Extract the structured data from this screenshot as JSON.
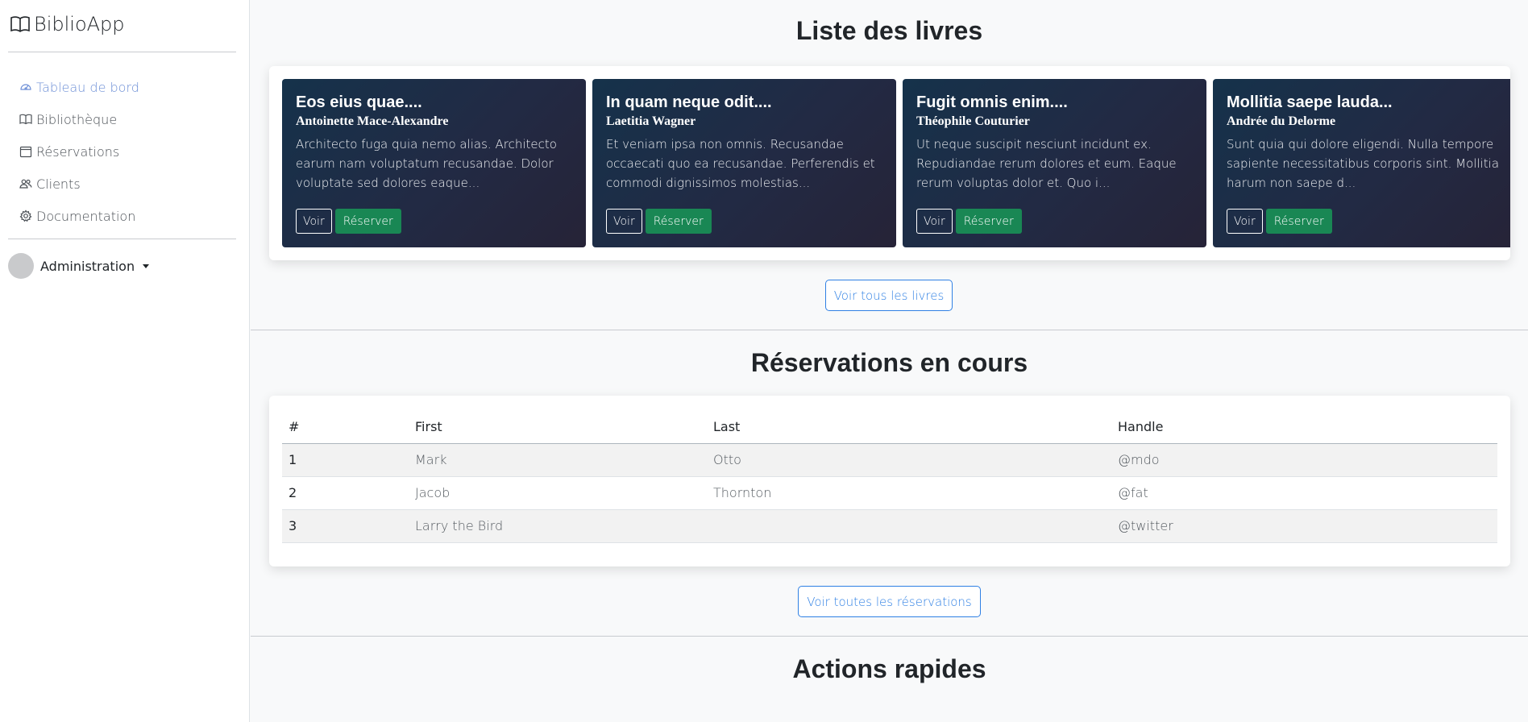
{
  "app": {
    "title": "BiblioApp"
  },
  "sidebar": {
    "items": [
      {
        "label": "Tableau de bord",
        "icon": "speedometer-icon",
        "active": true
      },
      {
        "label": "Bibliothèque",
        "icon": "book-icon"
      },
      {
        "label": "Réservations",
        "icon": "calendar-icon"
      },
      {
        "label": "Clients",
        "icon": "people-icon"
      },
      {
        "label": "Documentation",
        "icon": "gear-icon"
      }
    ],
    "user": {
      "label": "Administration"
    }
  },
  "books": {
    "title": "Liste des livres",
    "view_label": "Voir",
    "reserve_label": "Réserver",
    "all_button": "Voir tous les livres",
    "items": [
      {
        "title": "Eos eius quae....",
        "author": "Antoinette Mace-Alexandre",
        "description": "Architecto fuga quia nemo alias. Architecto earum nam voluptatum recusandae. Dolor voluptate sed dolores eaque..."
      },
      {
        "title": "In quam neque odit....",
        "author": "Laetitia Wagner",
        "description": "Et veniam ipsa non omnis. Recusandae occaecati quo ea recusandae. Perferendis et commodi dignissimos molestias..."
      },
      {
        "title": "Fugit omnis enim....",
        "author": "Théophile Couturier",
        "description": "Ut neque suscipit nesciunt incidunt ex. Repudiandae rerum dolores et eum. Eaque rerum voluptas dolor et. Quo i..."
      },
      {
        "title": "Mollitia saepe lauda...",
        "author": "Andrée du Delorme",
        "description": "Sunt quia qui dolore eligendi. Nulla tempore sapiente necessitatibus corporis sint. Mollitia harum non saepe d..."
      }
    ]
  },
  "reservations": {
    "title": "Réservations en cours",
    "columns": [
      "#",
      "First",
      "Last",
      "Handle"
    ],
    "rows": [
      [
        "1",
        "Mark",
        "Otto",
        "@mdo"
      ],
      [
        "2",
        "Jacob",
        "Thornton",
        "@fat"
      ],
      [
        "3",
        "Larry the Bird",
        "",
        "@twitter"
      ]
    ],
    "all_button": "Voir toutes les réservations"
  },
  "quick_actions": {
    "title": "Actions rapides"
  },
  "colors": {
    "accent": "#2f80e4",
    "success": "#198754",
    "active_nav": "#6d8fd6"
  }
}
